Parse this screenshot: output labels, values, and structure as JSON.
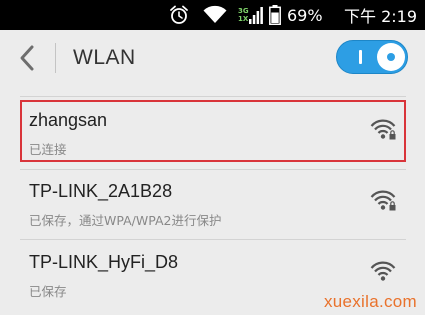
{
  "status_bar": {
    "network_type_top": "3G",
    "network_type_bottom": "1X",
    "battery_percent": "69%",
    "time": "下午 2:19",
    "icons": [
      "alarm-clock-icon",
      "wifi-icon",
      "signal-icon",
      "battery-icon"
    ]
  },
  "header": {
    "back_icon": "chevron-left-icon",
    "title": "WLAN",
    "wlan_toggle_on": true
  },
  "networks": [
    {
      "ssid": "zhangsan",
      "status": "已连接",
      "secured": true,
      "highlighted": true
    },
    {
      "ssid": "TP-LINK_2A1B28",
      "status": "已保存，通过WPA/WPA2进行保护",
      "secured": true,
      "highlighted": false
    },
    {
      "ssid": "TP-LINK_HyFi_D8",
      "status": "已保存",
      "secured": false,
      "highlighted": false
    }
  ],
  "watermark": "xuexila.com",
  "colors": {
    "status_bar_bg": "#000000",
    "page_bg": "#ececec",
    "toggle_on": "#2d9ee4",
    "highlight_border": "#d9343a",
    "watermark": "#e9722c",
    "network_type": "#7fd36a"
  }
}
